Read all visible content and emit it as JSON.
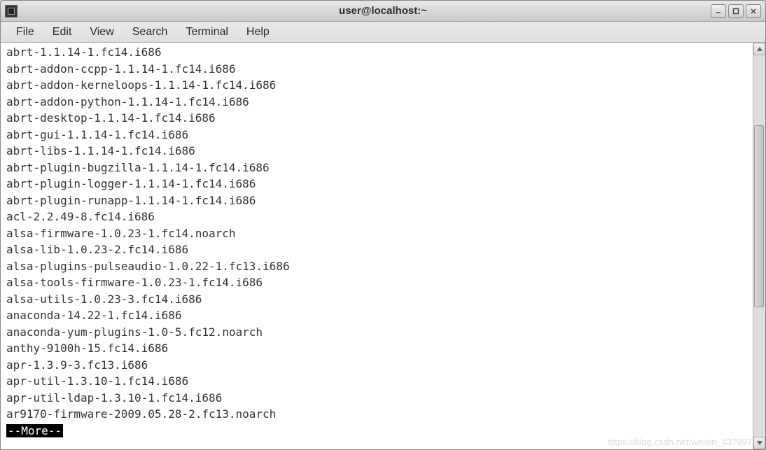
{
  "window": {
    "title": "user@localhost:~"
  },
  "menubar": {
    "items": [
      {
        "label": "File"
      },
      {
        "label": "Edit"
      },
      {
        "label": "View"
      },
      {
        "label": "Search"
      },
      {
        "label": "Terminal"
      },
      {
        "label": "Help"
      }
    ]
  },
  "terminal": {
    "lines": [
      "abrt-1.1.14-1.fc14.i686",
      "abrt-addon-ccpp-1.1.14-1.fc14.i686",
      "abrt-addon-kerneloops-1.1.14-1.fc14.i686",
      "abrt-addon-python-1.1.14-1.fc14.i686",
      "abrt-desktop-1.1.14-1.fc14.i686",
      "abrt-gui-1.1.14-1.fc14.i686",
      "abrt-libs-1.1.14-1.fc14.i686",
      "abrt-plugin-bugzilla-1.1.14-1.fc14.i686",
      "abrt-plugin-logger-1.1.14-1.fc14.i686",
      "abrt-plugin-runapp-1.1.14-1.fc14.i686",
      "acl-2.2.49-8.fc14.i686",
      "alsa-firmware-1.0.23-1.fc14.noarch",
      "alsa-lib-1.0.23-2.fc14.i686",
      "alsa-plugins-pulseaudio-1.0.22-1.fc13.i686",
      "alsa-tools-firmware-1.0.23-1.fc14.i686",
      "alsa-utils-1.0.23-3.fc14.i686",
      "anaconda-14.22-1.fc14.i686",
      "anaconda-yum-plugins-1.0-5.fc12.noarch",
      "anthy-9100h-15.fc14.i686",
      "apr-1.3.9-3.fc13.i686",
      "apr-util-1.3.10-1.fc14.i686",
      "apr-util-ldap-1.3.10-1.fc14.i686",
      "ar9170-firmware-2009.05.28-2.fc13.noarch"
    ],
    "more_prompt": "--More--"
  },
  "watermark": "https://blog.csdn.net/weixin_437997"
}
